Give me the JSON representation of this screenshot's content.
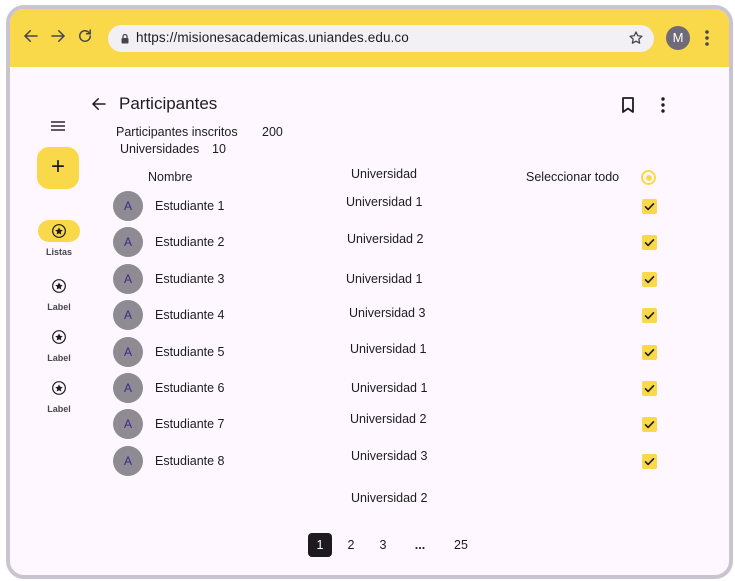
{
  "browser": {
    "url": "https://misionesacademicas.uniandes.edu.co",
    "profile_initial": "M",
    "accent_color": "#f9d949"
  },
  "rail": {
    "items": [
      {
        "label": "Listas",
        "icon": "star-circle-icon",
        "active": true
      },
      {
        "label": "Label",
        "icon": "star-circle-icon",
        "active": false
      },
      {
        "label": "Label",
        "icon": "star-circle-icon",
        "active": false
      },
      {
        "label": "Label",
        "icon": "star-circle-icon",
        "active": false
      }
    ]
  },
  "header": {
    "title": "Participantes"
  },
  "stats": {
    "participants_label": "Participantes inscritos",
    "participants_value": "200",
    "universities_label": "Universidades",
    "universities_value": "10"
  },
  "table": {
    "col_name": "Nombre",
    "col_university": "Universidad",
    "select_all": "Seleccionar todo",
    "rows": [
      {
        "avatar": "A",
        "name": "Estudiante 1",
        "university": "Universidad 1",
        "checked": true
      },
      {
        "avatar": "A",
        "name": "Estudiante 2",
        "university": "Universidad 2",
        "checked": true
      },
      {
        "avatar": "A",
        "name": "Estudiante 3",
        "university": "Universidad 1",
        "checked": true
      },
      {
        "avatar": "A",
        "name": "Estudiante 4",
        "university": "Universidad 3",
        "checked": true
      },
      {
        "avatar": "A",
        "name": "Estudiante 5",
        "university": "Universidad 1",
        "checked": true
      },
      {
        "avatar": "A",
        "name": "Estudiante 6",
        "university": "Universidad 1",
        "checked": true
      },
      {
        "avatar": "A",
        "name": "Estudiante 7",
        "university": "Universidad 2",
        "checked": true
      },
      {
        "avatar": "A",
        "name": "Estudiante 8",
        "university": "Universidad 3",
        "checked": true
      }
    ],
    "extra_university": "Universidad 2"
  },
  "pagination": {
    "pages": [
      "1",
      "2",
      "3",
      "...",
      "25"
    ],
    "current": "1"
  }
}
